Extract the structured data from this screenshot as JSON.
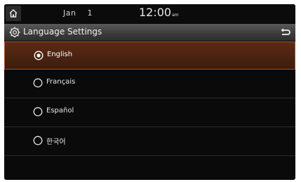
{
  "status": {
    "date_month": "Jan",
    "date_day": "1",
    "time": "12:00",
    "time_suffix": "am"
  },
  "header": {
    "title": "Language Settings",
    "icons": [
      "home-icon",
      "gear-icon",
      "back-icon"
    ]
  },
  "languages": {
    "items": [
      {
        "label": "English",
        "selected": true
      },
      {
        "label": "Français",
        "selected": false
      },
      {
        "label": "Español",
        "selected": false
      },
      {
        "label": "한국어",
        "selected": false
      }
    ]
  },
  "colors": {
    "accent": "#a4552c",
    "selected_bg": "#5c2a14",
    "background": "#0a0a0a"
  }
}
